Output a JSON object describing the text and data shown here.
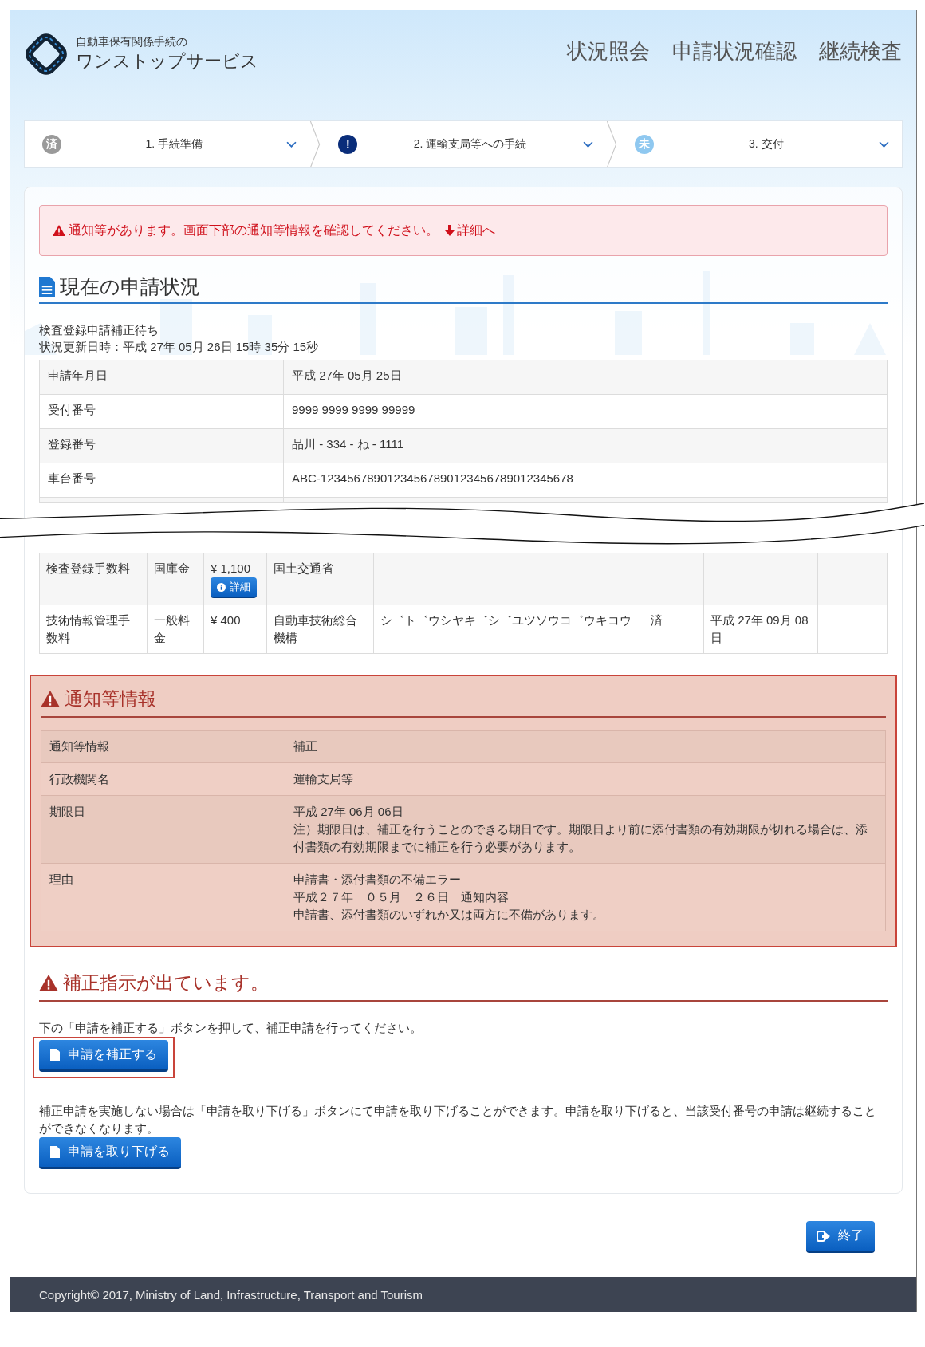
{
  "header": {
    "logo_subtitle": "自動車保有関係手続の",
    "logo_title": "ワンストップサービス",
    "nav": [
      "状況照会",
      "申請状況確認",
      "継続検査"
    ]
  },
  "steps": [
    {
      "badge": "済",
      "label": "1. 手続準備",
      "kind": "done"
    },
    {
      "badge": "!",
      "label": "2. 運輸支局等への手続",
      "kind": "alert"
    },
    {
      "badge": "未",
      "label": "3. 交付",
      "kind": "pending"
    }
  ],
  "alert": {
    "text": "通知等があります。画面下部の通知等情報を確認してください。",
    "link": "詳細へ"
  },
  "status": {
    "title": "現在の申請状況",
    "state": "検査登録申請補正待ち",
    "updated": "状況更新日時：平成 27年 05月 26日 15時 35分 15秒",
    "rows": [
      {
        "label": "申請年月日",
        "value": "平成 27年 05月 25日"
      },
      {
        "label": "受付番号",
        "value": "9999 9999 9999 99999"
      },
      {
        "label": "登録番号",
        "value": "品川 - 334 - ね - 1111"
      },
      {
        "label": "車台番号",
        "value": "ABC-12345678901234567890123456789012345678"
      }
    ]
  },
  "fees": {
    "rows": [
      {
        "cells": [
          "検査登録手数料",
          "国庫金",
          "¥ 1,100",
          "国土交通省"
        ],
        "detail_button": "詳細"
      },
      {
        "cells": [
          "技術情報管理手数料",
          "一般料金",
          "¥ 400",
          "自動車技術総合機構",
          "シ゛ト゛ウシヤキ゛シ゛ユツソウコ゛ウキコウ",
          "済",
          "平成 27年 09月 08日"
        ]
      }
    ]
  },
  "notice": {
    "title": "通知等情報",
    "rows": [
      {
        "label": "通知等情報",
        "lines": [
          "補正"
        ]
      },
      {
        "label": "行政機関名",
        "lines": [
          "運輸支局等"
        ]
      },
      {
        "label": "期限日",
        "lines": [
          "平成 27年 06月 06日",
          "注）期限日は、補正を行うことのできる期日です。期限日より前に添付書類の有効期限が切れる場合は、添付書類の有効期限までに補正を行う必要があります。"
        ]
      },
      {
        "label": "理由",
        "lines": [
          "申請書・添付書類の不備エラー",
          "平成２７年　０５月　２６日　通知内容",
          "申請書、添付書類のいずれか又は両方に不備があります。"
        ]
      }
    ]
  },
  "correction": {
    "title": "補正指示が出ています。",
    "instruction": "下の「申請を補正する」ボタンを押して、補正申請を行ってください。",
    "correct_button": {
      "label": "申請を補正する",
      "highlighted": true
    },
    "withdraw_text": "補正申請を実施しない場合は「申請を取り下げる」ボタンにて申請を取り下げることができます。申請を取り下げると、当該受付番号の申請は継続することができなくなります。",
    "withdraw_button": {
      "label": "申請を取り下げる"
    }
  },
  "exit_button": "終了",
  "footer": "Copyright© 2017, Ministry of Land, Infrastructure, Transport and Tourism"
}
